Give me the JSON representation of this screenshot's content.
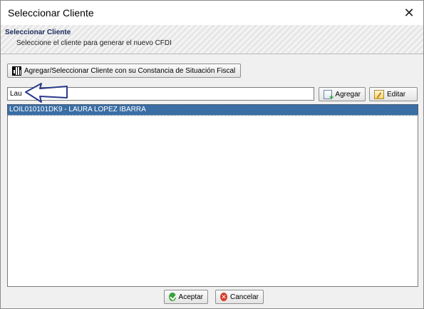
{
  "window": {
    "title": "Seleccionar Cliente",
    "close_glyph": "✕"
  },
  "banner": {
    "title": "Seleccionar Cliente",
    "subtitle": "Seleccione el cliente para generar el nuevo CFDI"
  },
  "toolbar": {
    "qr_button_label": "Agregar/Seleccionar Cliente con su Constancia de Situación Fiscal",
    "qr_icon": "qr-code-icon"
  },
  "search": {
    "value": "Lau",
    "placeholder": ""
  },
  "actions": {
    "add_label": "Agregar",
    "add_icon": "add-client-icon",
    "edit_label": "Editar",
    "edit_icon": "edit-client-icon"
  },
  "client_list": {
    "items": [
      {
        "label": "LOIL010101DK9 - LAURA LOPEZ IBARRA",
        "selected": true
      }
    ]
  },
  "footer": {
    "accept_label": "Aceptar",
    "accept_icon": "check-icon",
    "cancel_label": "Cancelar",
    "cancel_icon": "cancel-icon",
    "cancel_glyph": "✕"
  },
  "colors": {
    "selection": "#3a6ea5",
    "arrow_outline": "#2a3a8a",
    "banner_title": "#1a2a5a"
  }
}
